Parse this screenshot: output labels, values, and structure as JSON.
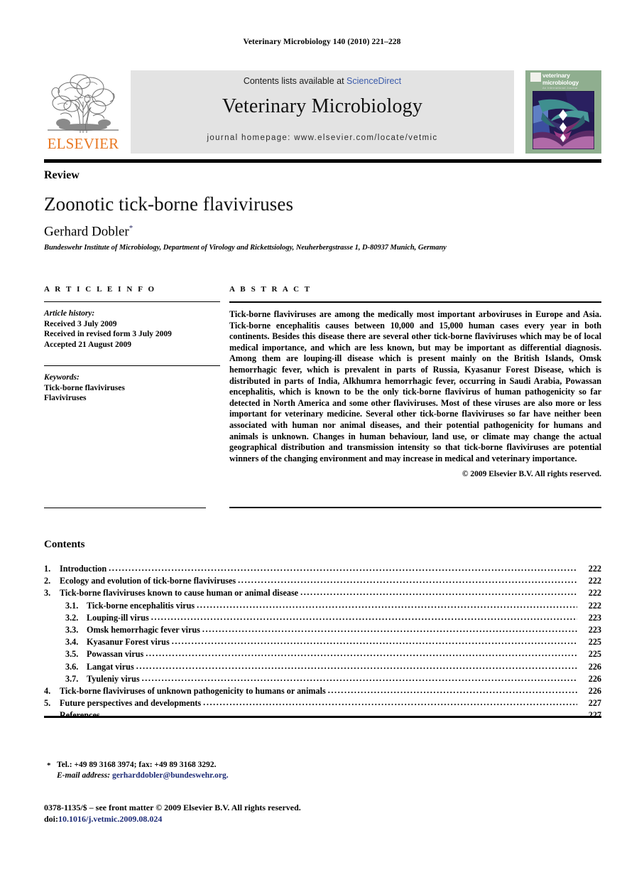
{
  "running_head": "Veterinary Microbiology 140 (2010) 221–228",
  "masthead": {
    "publisher_name": "ELSEVIER",
    "contents_prefix": "Contents lists available at",
    "contents_link": "ScienceDirect",
    "journal_title": "Veterinary Microbiology",
    "homepage": "journal homepage: www.elsevier.com/locate/vetmic",
    "cover": {
      "name_line1": "veterinary",
      "name_line2": "microbiology",
      "subtitle": "An International Journal"
    }
  },
  "title_block": {
    "doc_type": "Review",
    "title": "Zoonotic tick-borne flaviviruses",
    "author": "Gerhard Dobler",
    "author_mark": "*",
    "affiliation": "Bundeswehr Institute of Microbiology, Department of Virology and Rickettsiology, Neuherbergstrasse 1, D-80937 Munich, Germany"
  },
  "article_info": {
    "heading": "A R T I C L E  I N F O",
    "history_label": "Article history:",
    "history": [
      "Received 3 July 2009",
      "Received in revised form 3 July 2009",
      "Accepted 21 August 2009"
    ],
    "keywords_label": "Keywords:",
    "keywords": [
      "Tick-borne flaviviruses",
      "Flaviviruses"
    ]
  },
  "abstract": {
    "heading": "A B S T R A C T",
    "text": "Tick-borne flaviviruses are among the medically most important arboviruses in Europe and Asia. Tick-borne encephalitis causes between 10,000 and 15,000 human cases every year in both continents. Besides this disease there are several other tick-borne flaviviruses which may be of local medical importance, and which are less known, but may be important as differential diagnosis. Among them are louping-ill disease which is present mainly on the British Islands, Omsk hemorrhagic fever, which is prevalent in parts of Russia, Kyasanur Forest Disease, which is distributed in parts of India, Alkhumra hemorrhagic fever, occurring in Saudi Arabia, Powassan encephalitis, which is known to be the only tick-borne flavivirus of human pathogenicity so far detected in North America and some other flaviviruses. Most of these viruses are also more or less important for veterinary medicine. Several other tick-borne flaviviruses so far have neither been associated with human nor animal diseases, and their potential pathogenicity for humans and animals is unknown. Changes in human behaviour, land use, or climate may change the actual geographical distribution and transmission intensity so that tick-borne flaviviruses are potential winners of the changing environment and may increase in medical and veterinary importance.",
    "copyright": "© 2009 Elsevier B.V. All rights reserved."
  },
  "contents": {
    "heading": "Contents",
    "entries": [
      {
        "num": "1.",
        "label": "Introduction",
        "page": "222",
        "level": 1
      },
      {
        "num": "2.",
        "label": "Ecology and evolution of tick-borne flaviviruses",
        "page": "222",
        "level": 1
      },
      {
        "num": "3.",
        "label": "Tick-borne flaviviruses known to cause human or animal disease",
        "page": "222",
        "level": 1
      },
      {
        "num": "3.1.",
        "label": "Tick-borne encephalitis virus",
        "page": "222",
        "level": 2
      },
      {
        "num": "3.2.",
        "label": "Louping-ill virus",
        "page": "223",
        "level": 2
      },
      {
        "num": "3.3.",
        "label": "Omsk hemorrhagic fever virus",
        "page": "223",
        "level": 2
      },
      {
        "num": "3.4.",
        "label": "Kyasanur Forest virus",
        "page": "225",
        "level": 2
      },
      {
        "num": "3.5.",
        "label": "Powassan virus",
        "page": "225",
        "level": 2
      },
      {
        "num": "3.6.",
        "label": "Langat virus",
        "page": "226",
        "level": 2
      },
      {
        "num": "3.7.",
        "label": "Tyuleniy virus",
        "page": "226",
        "level": 2
      },
      {
        "num": "4.",
        "label": "Tick-borne flaviviruses of unknown pathogenicity to humans or animals",
        "page": "226",
        "level": 1
      },
      {
        "num": "5.",
        "label": "Future perspectives and developments",
        "page": "227",
        "level": 1
      },
      {
        "num": "",
        "label": "References",
        "page": "227",
        "level": 1
      }
    ]
  },
  "footnote": {
    "mark": "*",
    "contact": "Tel.: +49 89 3168 3974; fax: +49 89 3168 3292.",
    "email_label": "E-mail address:",
    "email": "gerharddobler@bundeswehr.org."
  },
  "footer": {
    "issn_line": "0378-1135/$ – see front matter © 2009 Elsevier B.V. All rights reserved.",
    "doi_label": "doi:",
    "doi": "10.1016/j.vetmic.2009.08.024"
  },
  "colors": {
    "elsevier_orange": "#e87722",
    "link_blue": "#3b5bab",
    "banner_gray": "#e3e3e3",
    "cover_green": "#8fae8f"
  }
}
